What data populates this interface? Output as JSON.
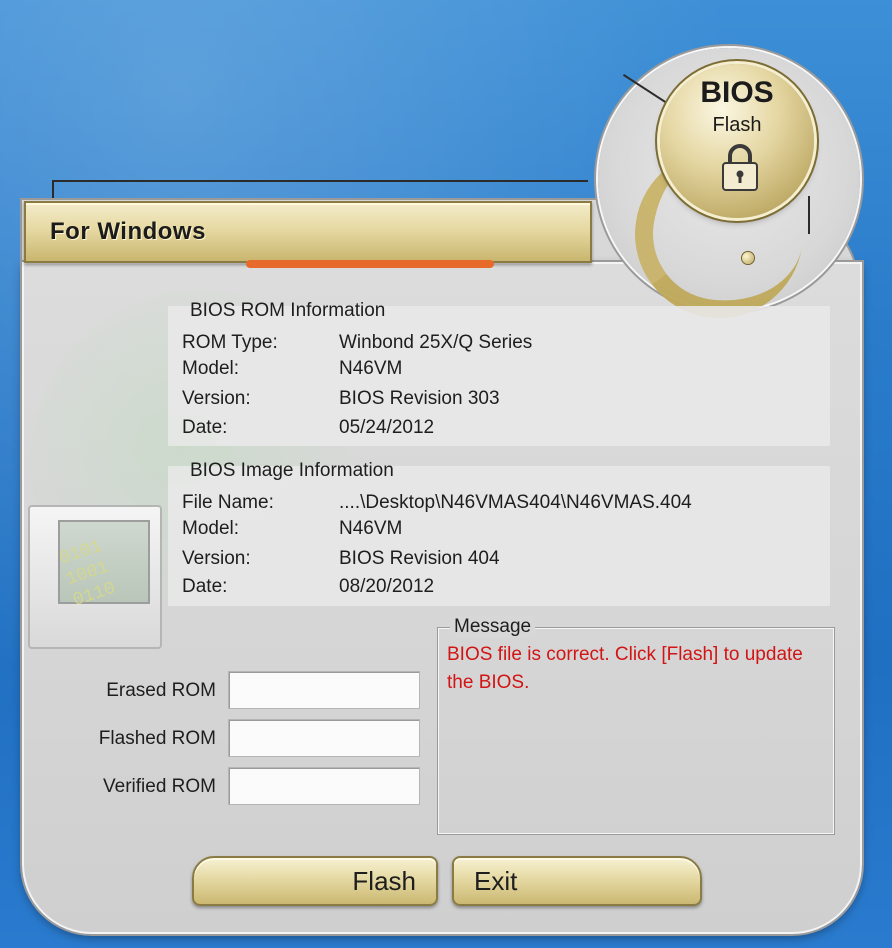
{
  "header": {
    "title": "For Windows"
  },
  "logo": {
    "title": "BIOS",
    "subtitle": "Flash",
    "icon": "lock-icon"
  },
  "rom_info": {
    "title": "BIOS ROM Information",
    "rows": [
      {
        "label": "ROM Type:",
        "value": "Winbond 25X/Q Series"
      },
      {
        "label": "Model:",
        "value": "N46VM"
      },
      {
        "label": "Version:",
        "value": "BIOS Revision 303"
      },
      {
        "label": "Date:",
        "value": "05/24/2012"
      }
    ]
  },
  "image_info": {
    "title": "BIOS Image Information",
    "rows": [
      {
        "label": "File Name:",
        "value": "....\\Desktop\\N46VMAS404\\N46VMAS.404"
      },
      {
        "label": "Model:",
        "value": "N46VM"
      },
      {
        "label": "Version:",
        "value": "BIOS Revision 404"
      },
      {
        "label": "Date:",
        "value": "08/20/2012"
      }
    ]
  },
  "progress": {
    "erased_label": "Erased ROM",
    "flashed_label": "Flashed ROM",
    "verified_label": "Verified ROM",
    "erased_value": "",
    "flashed_value": "",
    "verified_value": ""
  },
  "message": {
    "legend": "Message",
    "text": "BIOS file is correct. Click [Flash] to update the BIOS.",
    "color": "#d21414"
  },
  "buttons": {
    "flash": "Flash",
    "exit": "Exit"
  },
  "colors": {
    "accent_gold": "#e6d9a2",
    "panel": "#d8d8d8",
    "desktop": "#2a7ccb",
    "strip": "#e86a2a"
  }
}
